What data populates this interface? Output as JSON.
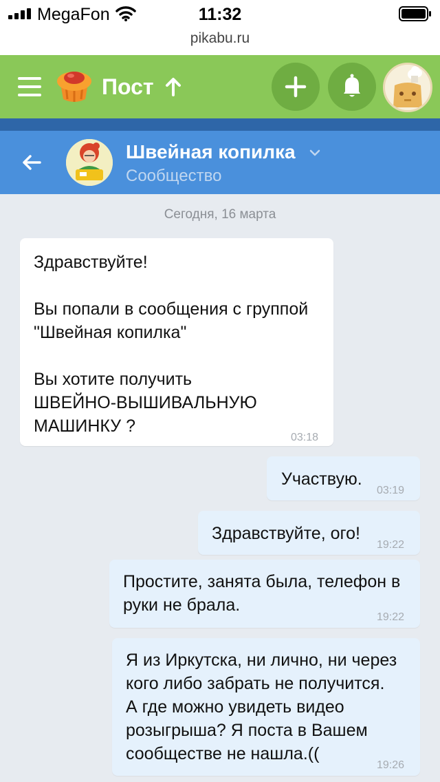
{
  "status_bar": {
    "carrier": "MegaFon",
    "time": "11:32"
  },
  "browser": {
    "url": "pikabu.ru"
  },
  "site_header": {
    "title": "Пост"
  },
  "chat_header": {
    "name": "Швейная копилка",
    "subtitle": "Сообщество"
  },
  "date_divider": "Сегодня, 16 марта",
  "messages": [
    {
      "side": "in",
      "lines": [
        "Здравствуйте!",
        "",
        "Вы попали в сообщения с группой",
        "\"Швейная копилка\"",
        "",
        "Вы хотите получить",
        "ШВЕЙНО-ВЫШИВАЛЬНУЮ",
        "МАШИНКУ ?"
      ],
      "time": "03:18"
    },
    {
      "side": "out",
      "lines": [
        "Участвую."
      ],
      "time": "03:19"
    },
    {
      "side": "out",
      "lines": [
        "Здравствуйте, ого!"
      ],
      "time": "19:22"
    },
    {
      "side": "out",
      "lines": [
        "Простите, занята была, телефон в",
        "руки не брала."
      ],
      "time": "19:22"
    },
    {
      "side": "out",
      "lines": [
        "Я из Иркутска, ни лично, ни через",
        "кого либо забрать не получится.",
        "А где можно увидеть видео",
        "розыгрыша? Я поста в Вашем",
        "сообществе не нашла.(("
      ],
      "time": "19:26"
    }
  ],
  "colors": {
    "green_header": "#8ac858",
    "blue_header": "#4a90dc",
    "outgoing_bubble": "#e5f1fc",
    "chat_background": "#e7ebf0"
  },
  "icons": [
    "signal-icon",
    "wifi-icon",
    "battery-icon",
    "menu-icon",
    "pikabu-logo-icon",
    "arrow-up-icon",
    "plus-icon",
    "bell-icon",
    "user-avatar",
    "back-arrow-icon",
    "community-avatar",
    "chevron-down-icon"
  ]
}
